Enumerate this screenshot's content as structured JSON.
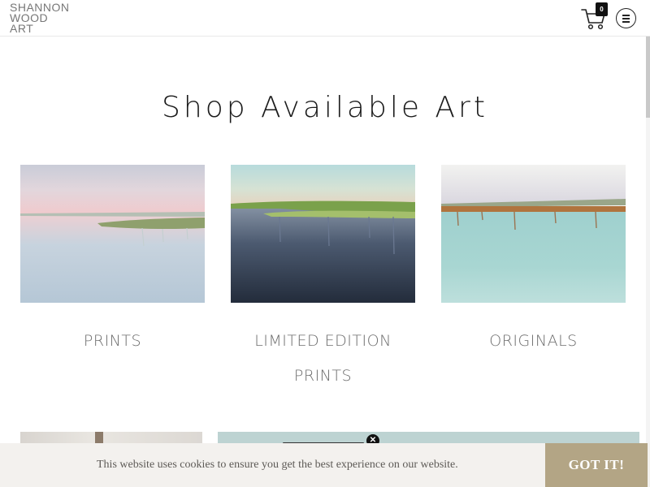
{
  "header": {
    "logo_lines": [
      "SHANNON",
      "WOOD",
      "ART"
    ],
    "cart_count": "0",
    "cart_icon": "cart-icon",
    "menu_icon": "hamburger-menu-icon"
  },
  "main": {
    "title": "Shop Available Art",
    "categories": [
      {
        "label": "PRINTS",
        "image": "pink-sky-marsh-painting"
      },
      {
        "label": "LIMITED EDITION PRINTS",
        "image": "dark-water-marsh-painting"
      },
      {
        "label": "ORIGINALS",
        "image": "aqua-water-marsh-painting"
      }
    ]
  },
  "popup": {
    "close_icon": "close-icon"
  },
  "cookie": {
    "text": "This website uses cookies to ensure you get the best experience on our website.",
    "button": "GOT IT!"
  },
  "colors": {
    "accent": "#b3a585",
    "cookie_bg": "#f3f1ee",
    "panel": "#bdd3d2",
    "label_text": "#6d6d6d"
  }
}
